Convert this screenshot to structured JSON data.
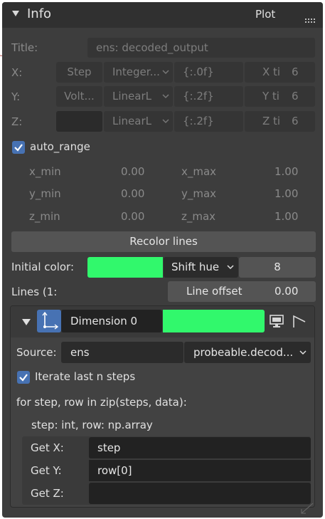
{
  "header": {
    "title": "Info",
    "tab": "Plot"
  },
  "title_row": {
    "label": "Title:",
    "value": "ens: decoded_output"
  },
  "axes": [
    {
      "label": "X:",
      "source": "Step",
      "scale": "Integer...",
      "format": "{:.0f}",
      "ticks_label": "X ti",
      "ticks_value": "6"
    },
    {
      "label": "Y:",
      "source": "Volt...",
      "scale": "LinearL",
      "format": "{:.2f}",
      "ticks_label": "Y ti",
      "ticks_value": "6"
    },
    {
      "label": "Z:",
      "source": "",
      "scale": "LinearL",
      "format": "{:.2f}",
      "ticks_label": "Z ti",
      "ticks_value": "6"
    }
  ],
  "auto_range": {
    "label": "auto_range",
    "checked": true
  },
  "ranges": [
    {
      "min_label": "x_min",
      "min_value": "0.00",
      "max_label": "x_max",
      "max_value": "1.00"
    },
    {
      "min_label": "y_min",
      "min_value": "0.00",
      "max_label": "y_max",
      "max_value": "1.00"
    },
    {
      "min_label": "z_min",
      "min_value": "0.00",
      "max_label": "z_max",
      "max_value": "1.00"
    }
  ],
  "recolor_button": "Recolor lines",
  "initial_color": {
    "label": "Initial color:",
    "swatch_color": "#31f86c",
    "mode": "Shift hue",
    "value": "8"
  },
  "lines": {
    "label": "Lines (1:",
    "offset_label": "Line offset",
    "offset_value": "0.00"
  },
  "dimension": {
    "name": "Dimension 0",
    "color": "#31f86c"
  },
  "source": {
    "label": "Source:",
    "value": "ens",
    "probe": "probeable.decod..."
  },
  "iterate": {
    "label": "Iterate last n steps",
    "checked": true
  },
  "code": {
    "line1": "for step, row in zip(steps, data):",
    "line2": "step: int, row: np.array"
  },
  "getters": [
    {
      "label": "Get X:",
      "value": "step"
    },
    {
      "label": "Get Y:",
      "value": "row[0]"
    },
    {
      "label": "Get Z:",
      "value": ""
    }
  ],
  "colors": {
    "panel": "#3d3d3d",
    "field": "#2b2b2b",
    "button": "#545454",
    "accent": "#4772b3",
    "green": "#31f86c"
  }
}
